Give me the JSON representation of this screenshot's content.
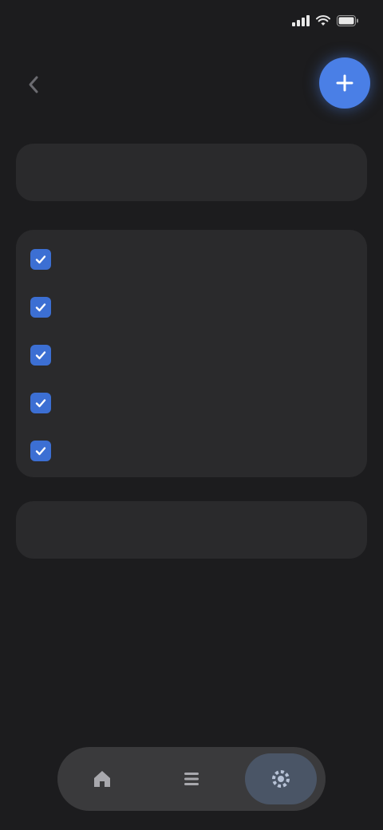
{
  "status_bar": {
    "time": "",
    "icons": [
      "signal-icon",
      "wifi-icon",
      "battery-icon"
    ]
  },
  "header": {
    "title": "",
    "back_icon": "chevron-left-icon",
    "action_icon": "plus-icon"
  },
  "date_row": {
    "label": "",
    "value": ""
  },
  "items": [
    {
      "name": "",
      "value": "",
      "checked": true
    },
    {
      "name": "",
      "value": "",
      "checked": true
    },
    {
      "name": "",
      "value": "",
      "checked": true
    },
    {
      "name": "",
      "value": "",
      "checked": true
    },
    {
      "name": "",
      "value": "",
      "checked": true
    }
  ],
  "action_button": {
    "label": ""
  },
  "tab_bar": {
    "tabs": [
      {
        "icon": "home-icon",
        "active": false
      },
      {
        "icon": "list-icon",
        "active": false
      },
      {
        "icon": "settings-icon",
        "active": true
      }
    ]
  },
  "colors": {
    "background": "#1c1c1e",
    "card": "#2a2a2c",
    "accent": "#4a7fe6",
    "checkbox": "#3c6fd3",
    "tab_bar": "#3a3a3c",
    "active_tab": "#4a5566"
  }
}
